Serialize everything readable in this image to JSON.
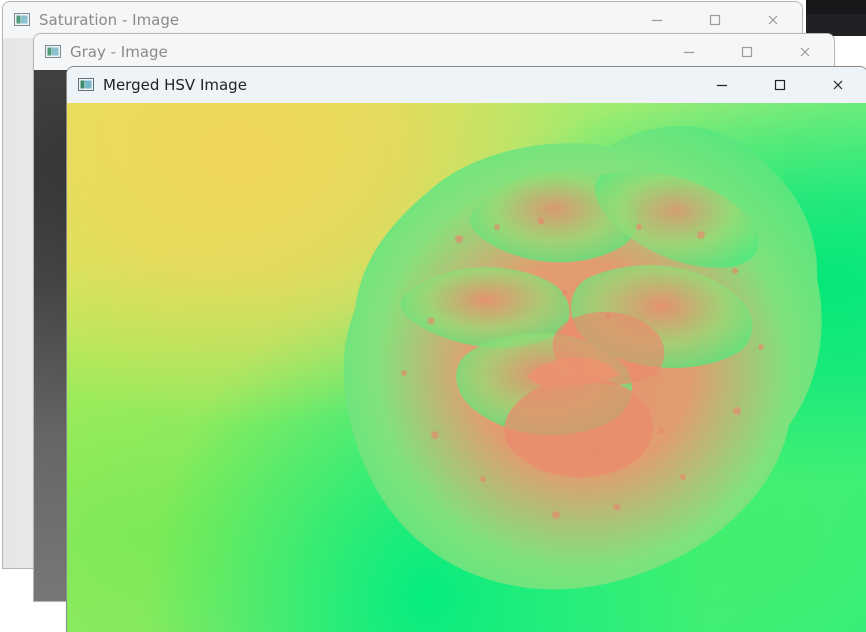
{
  "windows": {
    "saturation": {
      "title": "Saturation - Image"
    },
    "gray": {
      "title": "Gray - Image"
    },
    "hsv": {
      "title": "Merged HSV Image"
    }
  },
  "icons": {
    "app": "window-app-icon",
    "minimize": "minimize-icon",
    "maximize": "maximize-icon",
    "close": "close-icon"
  },
  "colors": {
    "active_titlebar": "#eef3f8",
    "inactive_titlebar": "#f5f6f7",
    "desktop_dark_corner": "#17181a"
  }
}
